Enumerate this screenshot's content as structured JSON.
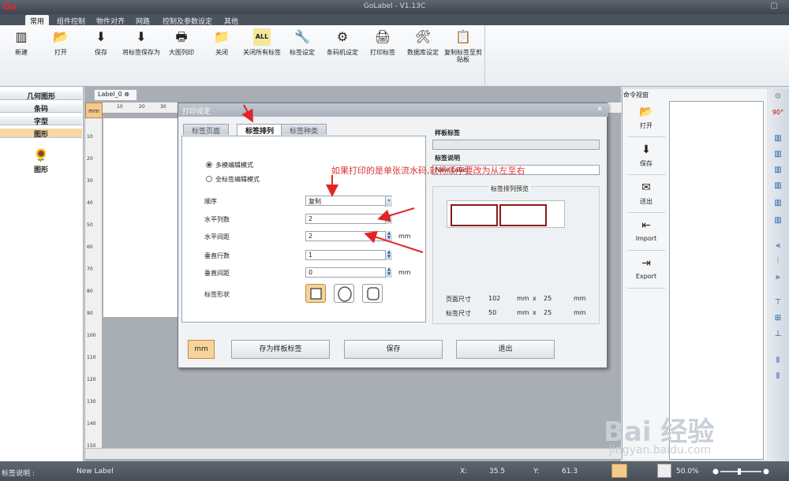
{
  "app": {
    "title": "GoLabel - V1.13C",
    "logo": "Go"
  },
  "menu": {
    "tabs": [
      "常用",
      "组件控制",
      "物件对齐",
      "网路",
      "控制及参数设定",
      "其他"
    ]
  },
  "ribbon": {
    "buttons": [
      {
        "label": "新建",
        "icon": "barcode-new-icon"
      },
      {
        "label": "打开",
        "icon": "open-folder-icon"
      },
      {
        "label": "保存",
        "icon": "save-icon"
      },
      {
        "label": "将标签保存为",
        "icon": "save-as-icon"
      },
      {
        "label": "大图列印",
        "icon": "big-print-icon"
      },
      {
        "label": "关闭",
        "icon": "close-folder-icon"
      },
      {
        "label": "关闭所有标签",
        "icon": "close-all-icon"
      },
      {
        "label": "标签设定",
        "icon": "label-settings-icon"
      },
      {
        "label": "条码机设定",
        "icon": "printer-settings-icon"
      },
      {
        "label": "打印标签",
        "icon": "print-label-icon"
      },
      {
        "label": "数据库设定",
        "icon": "database-icon"
      },
      {
        "label": "复制标签至剪贴板",
        "icon": "copy-clipboard-icon"
      }
    ]
  },
  "left_panel": {
    "items": [
      "几何图形",
      "条码",
      "字型",
      "图形"
    ],
    "selected": "图形",
    "image_item": "图形"
  },
  "document": {
    "tab": "Label_0",
    "unit_corner": "mm",
    "ruler_top": [
      "10",
      "20",
      "30"
    ],
    "ruler_left": [
      "10",
      "20",
      "30",
      "40",
      "50",
      "60",
      "70",
      "80",
      "90",
      "100",
      "110",
      "120",
      "130",
      "140",
      "150"
    ]
  },
  "command_window": {
    "title": "命令视窗",
    "buttons": [
      {
        "label": "打开",
        "icon": "open-cmd-icon"
      },
      {
        "label": "保存",
        "icon": "save-cmd-icon"
      },
      {
        "label": "送出",
        "icon": "send-icon"
      },
      {
        "label": "Import",
        "icon": "import-icon"
      },
      {
        "label": "Export",
        "icon": "export-icon"
      }
    ]
  },
  "dialog": {
    "title": "打印设定",
    "tabs": [
      "标签页面",
      "标签排列",
      "标签种类"
    ],
    "active_tab": "标签排列",
    "modes": [
      "多模编辑模式",
      "全标签编辑模式"
    ],
    "fields": {
      "order_label": "顺序",
      "order_value": "复制",
      "hcols_label": "水平列数",
      "hcols_value": "2",
      "hgap_label": "水平间距",
      "hgap_value": "2",
      "vrows_label": "垂直行数",
      "vrows_value": "1",
      "vgap_label": "垂直间距",
      "vgap_value": "0",
      "shape_label": "标签形状",
      "unit": "mm"
    },
    "template_label": "样板标签",
    "description_label": "标签说明",
    "description_value": "New Label",
    "preview_title": "标签排列预览",
    "page_size_label": "页面尺寸",
    "page_w": "102",
    "page_h": "25",
    "label_size_label": "标签尺寸",
    "label_w": "50",
    "label_h": "25",
    "mm": "mm",
    "x": "x",
    "buttons": {
      "unit": "mm",
      "save_template": "存为样板标签",
      "save": "保存",
      "exit": "退出"
    }
  },
  "annotation": "如果打印的是单张流水码,就将顺序要改为从左至右",
  "status": {
    "desc_label": "标签说明 :",
    "desc_value": "New Label",
    "x_label": "X:",
    "x_value": "35.5",
    "y_label": "Y:",
    "y_value": "61.3",
    "zoom": "50.0%"
  },
  "watermark": {
    "main": "Bai 经验",
    "sub": "jingyan.baidu.com"
  },
  "colors": {
    "accent": "#f6d39c",
    "annotation": "#dd3333",
    "preview_border": "#8b1b1b"
  }
}
